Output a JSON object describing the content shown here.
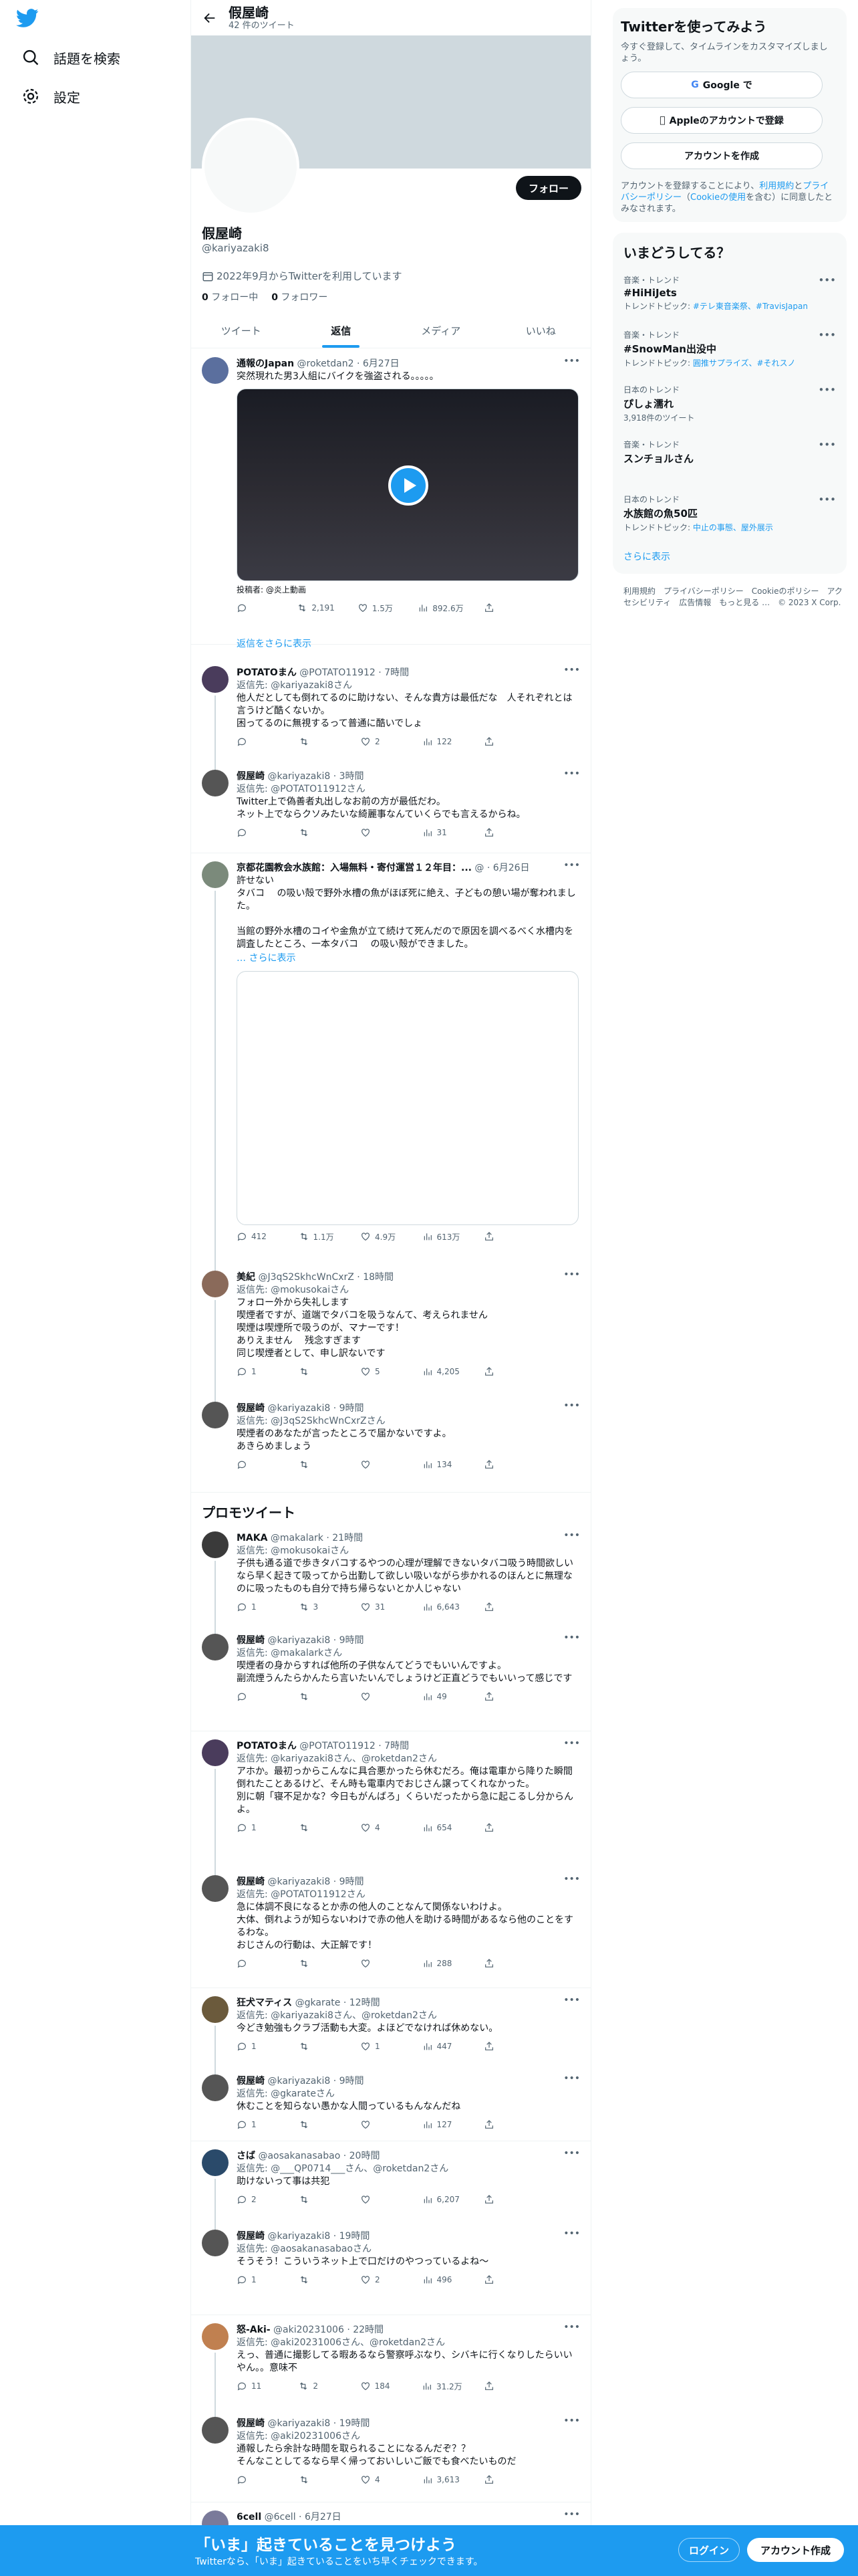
{
  "nav": {
    "explore": "話題を検索",
    "settings": "設定"
  },
  "header": {
    "name": "假屋崎",
    "tweet_count": "42 件のツイート"
  },
  "profile": {
    "follow": "フォロー",
    "name": "假屋崎",
    "handle": "@kariyazaki8",
    "joined": "2022年9月からTwitterを利用しています",
    "following_count": "0",
    "following_label": "フォロー中",
    "followers_count": "0",
    "followers_label": "フォロワー"
  },
  "tabs": [
    "ツイート",
    "返信",
    "メディア",
    "いいね"
  ],
  "tweets": [
    {
      "name": "通報のJapan",
      "handle": "@roketdan2",
      "time": "6月27日",
      "text": "突然現れた男3人組にバイクを強盗される。。。。。",
      "video_caption": "投稿者: @炎上動画",
      "reply": "",
      "c": "",
      "r": "2,191",
      "l": "1.5万",
      "v": "892.6万"
    },
    {
      "name": "POTATOまん",
      "handle": "@POTATO11912",
      "time": "7時間",
      "reply": "返信先: @kariyazaki8さん",
      "text": "他人だとしても倒れてるのに助けない、そんな貴方は最低だな　人それぞれとは言うけど酷くないか。\n困ってるのに無視するって普通に酷いでしょ",
      "c": "",
      "r": "",
      "l": "2",
      "v": "122"
    },
    {
      "name": "假屋崎",
      "handle": "@kariyazaki8",
      "time": "3時間",
      "reply": "返信先: @POTATO11912さん",
      "text": "Twitter上で偽善者丸出しなお前の方が最低だわ。\nネット上でならクソみたいな綺麗事なんていくらでも言えるからね。",
      "c": "",
      "r": "",
      "l": "",
      "v": "31"
    },
    {
      "name": "京都花園教会水族館：入場無料・寄付運営１２年目：...",
      "handle": "@",
      "time": "6月26日",
      "reply": "",
      "text": "許せない\nタバコ　 の吸い殻で野外水槽の魚がほぼ死に絶え、子どもの憩い場が奪われました。\n\n当館の野外水槽のコイや金魚が立て続けて死んだので原因を調べるべく水槽内を調査したところ、一本タバコ　 の吸い殻ができました。",
      "more": "… さらに表示",
      "c": "412",
      "r": "1.1万",
      "l": "4.9万",
      "v": "613万"
    },
    {
      "name": "美紀",
      "handle": "@J3qS2SkhcWnCxrZ",
      "time": "18時間",
      "reply": "返信先: @mokusokaiさん",
      "text": "フォロー外から失礼します\n喫煙者ですが、道端でタバコを吸うなんて、考えられません\n喫煙は喫煙所で吸うのが、マナーです！\nありえません　 残念すぎます\n同じ喫煙者として、申し訳ないです",
      "c": "1",
      "r": "",
      "l": "5",
      "v": "4,205"
    },
    {
      "name": "假屋崎",
      "handle": "@kariyazaki8",
      "time": "9時間",
      "reply": "返信先: @J3qS2SkhcWnCxrZさん",
      "text": "喫煙者のあなたが言ったところで届かないですよ。\nあきらめましょう",
      "c": "",
      "r": "",
      "l": "",
      "v": "134"
    },
    {
      "name": "MAKA",
      "handle": "@makalark",
      "time": "21時間",
      "reply": "返信先: @mokusokaiさん",
      "text": "子供も通る道で歩きタバコするやつの心理が理解できないタバコ吸う時間欲しいなら早く起きて吸ってから出勤して欲しい吸いながら歩かれるのほんとに無理なのに吸ったものも自分で持ち帰らないとか人じゃない",
      "c": "1",
      "r": "3",
      "l": "31",
      "v": "6,643"
    },
    {
      "name": "假屋崎",
      "handle": "@kariyazaki8",
      "time": "9時間",
      "reply": "返信先: @makalarkさん",
      "text": "喫煙者の身からすれば他所の子供なんてどうでもいいんですよ。\n副流煙うんたらかんたら言いたいんでしょうけど正直どうでもいいって感じです",
      "c": "",
      "r": "",
      "l": "",
      "v": "49"
    },
    {
      "name": "POTATOまん",
      "handle": "@POTATO11912",
      "time": "7時間",
      "reply": "返信先: @kariyazaki8さん、@roketdan2さん",
      "text": "アホか。最初っからこんなに具合悪かったら休むだろ。俺は電車から降りた瞬間倒れたことあるけど、そん時も電車内でおじさん譲ってくれなかった。\n別に朝「寝不足かな？今日もがんばろ」くらいだったから急に起こるし分からんよ。",
      "c": "1",
      "r": "",
      "l": "4",
      "v": "654"
    },
    {
      "name": "假屋崎",
      "handle": "@kariyazaki8",
      "time": "9時間",
      "reply": "返信先: @POTATO11912さん",
      "text": "急に体調不良になるとか赤の他人のことなんて関係ないわけよ。\n大体、倒れようが知らないわけで赤の他人を助ける時間があるなら他のことをするわな。\nおじさんの行動は、大正解です！",
      "c": "",
      "r": "",
      "l": "",
      "v": "288"
    },
    {
      "name": "狂犬マティス",
      "handle": "@gkarate",
      "time": "12時間",
      "reply": "返信先: @kariyazaki8さん、@roketdan2さん",
      "text": "今どき勉強もクラブ活動も大変。よほどでなければ休めない。",
      "c": "1",
      "r": "",
      "l": "1",
      "v": "447"
    },
    {
      "name": "假屋崎",
      "handle": "@kariyazaki8",
      "time": "9時間",
      "reply": "返信先: @gkarateさん",
      "text": "休むことを知らない愚かな人間っているもんなんだね",
      "c": "1",
      "r": "",
      "l": "",
      "v": "127"
    },
    {
      "name": "さば",
      "handle": "@aosakanasabao",
      "time": "20時間",
      "reply": "返信先: @___QP0714___さん、@roketdan2さん",
      "text": "助けないって事は共犯",
      "c": "2",
      "r": "",
      "l": "",
      "v": "6,207"
    },
    {
      "name": "假屋崎",
      "handle": "@kariyazaki8",
      "time": "19時間",
      "reply": "返信先: @aosakanasabaoさん",
      "text": "そうそう！こういうネット上で口だけのやつっているよね〜",
      "c": "1",
      "r": "",
      "l": "2",
      "v": "496"
    },
    {
      "name": "怒-Aki-",
      "handle": "@aki20231006",
      "time": "22時間",
      "reply": "返信先: @aki20231006さん、@roketdan2さん",
      "text": "えっ、普通に撮影してる暇あるなら警察呼ぶなり、シバキに行くなりしたらいいやん。。意味不",
      "c": "11",
      "r": "2",
      "l": "184",
      "v": "31.2万"
    },
    {
      "name": "假屋崎",
      "handle": "@kariyazaki8",
      "time": "19時間",
      "reply": "返信先: @aki20231006さん",
      "text": "通報したら余計な時間を取られることになるんだぞ？？\nそんなことしてるなら早く帰っておいしいご飯でも食べたいものだ",
      "c": "",
      "r": "",
      "l": "4",
      "v": "3,613"
    },
    {
      "name": "6cell",
      "handle": "@6cell",
      "time": "6月27日",
      "reply": "",
      "text": "",
      "c": "",
      "r": "",
      "l": "",
      "v": ""
    }
  ],
  "show_replies": "返信をさらに表示",
  "promoted": "プロモツイート",
  "right": {
    "signup_title": "Twitterを使ってみよう",
    "signup_sub": "今すぐ登録して、タイムラインをカスタマイズしましょう。",
    "google": "Google で",
    "apple": "Appleのアカウントで登録",
    "create": "アカウントを作成",
    "terms_a": "アカウントを登録することにより、",
    "terms_link1": "利用規約",
    "terms_b": "と",
    "terms_link2": "プライバシーポリシー",
    "terms_c": "（",
    "terms_link3": "Cookieの使用",
    "terms_d": "を含む）に同意したとみなされます。",
    "trends_title": "いまどうしてる？",
    "trends": [
      {
        "cat": "音楽・トレンド",
        "name": "#HiHiJets",
        "sub_a": "トレンドトピック: ",
        "sub_b": "#テレ東音楽祭、#TravisJapan"
      },
      {
        "cat": "音楽・トレンド",
        "name": "#SnowMan出没中",
        "sub_a": "トレンドトピック: ",
        "sub_b": "圓推サプライズ、#それスノ"
      },
      {
        "cat": "日本のトレンド",
        "name": "ぴしょ濡れ",
        "sub_a": "3,918件のツイート",
        "sub_b": ""
      },
      {
        "cat": "音楽・トレンド",
        "name": "スンチョルさん",
        "sub_a": "",
        "sub_b": ""
      },
      {
        "cat": "日本のトレンド",
        "name": "水族館の魚50匹",
        "sub_a": "トレンドトピック: ",
        "sub_b": "中止の事態、屋外展示"
      }
    ],
    "show_more": "さらに表示",
    "footer": "利用規約　プライバシーポリシー　Cookieのポリシー　アクセシビリティ　広告情報　もっと見る …　© 2023 X Corp."
  },
  "bottom": {
    "title": "「いま」起きていることを見つけよう",
    "sub": "Twitterなら、「いま」起きていることをいち早くチェックできます。",
    "login": "ログイン",
    "signup": "アカウント作成"
  },
  "colors": {
    "accent": "#1d9bf0",
    "dark": "#0f1419"
  }
}
